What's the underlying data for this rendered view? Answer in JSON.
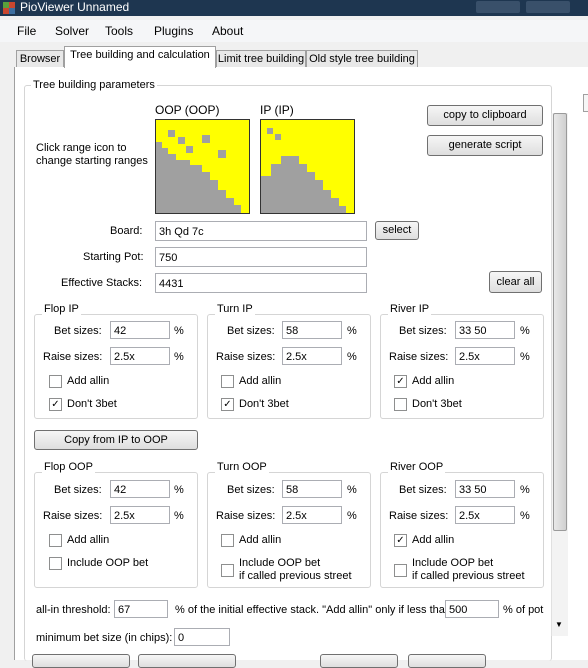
{
  "window": {
    "title": "PioViewer Unnamed"
  },
  "menu": [
    "File",
    "Solver",
    "Tools",
    "Plugins",
    "About"
  ],
  "tabs": [
    "Browser",
    "Tree building and calculation",
    "Limit tree building",
    "Old style tree building"
  ],
  "params": {
    "group_title": "Tree building parameters",
    "hint_line1": "Click range icon to",
    "hint_line2": "change starting ranges",
    "oop_label": "OOP (OOP)",
    "ip_label": "IP (IP)",
    "copy_button": "copy to clipboard",
    "script_button": "generate script",
    "board_label": "Board:",
    "board_value": "3h Qd 7c",
    "select_button": "select",
    "pot_label": "Starting Pot:",
    "pot_value": "750",
    "stacks_label": "Effective Stacks:",
    "stacks_value": "4431",
    "clear_button": "clear all"
  },
  "ranges": {
    "highlight_color": "#ffff00",
    "base_color": "#a0a0a0"
  },
  "ip_groups": [
    {
      "title": "Flop IP",
      "bet_label": "Bet sizes:",
      "bet": "42",
      "raise_label": "Raise sizes:",
      "raise": "2.5x",
      "pct": "%",
      "allin_label": "Add allin",
      "allin": "",
      "extra_label": "Don't 3bet",
      "extra": "✓"
    },
    {
      "title": "Turn IP",
      "bet_label": "Bet sizes:",
      "bet": "58",
      "raise_label": "Raise sizes:",
      "raise": "2.5x",
      "pct": "%",
      "allin_label": "Add allin",
      "allin": "",
      "extra_label": "Don't 3bet",
      "extra": "✓"
    },
    {
      "title": "River IP",
      "bet_label": "Bet sizes:",
      "bet": "33 50",
      "raise_label": "Raise sizes:",
      "raise": "2.5x",
      "pct": "%",
      "allin_label": "Add allin",
      "allin": "✓",
      "extra_label": "Don't 3bet",
      "extra": ""
    }
  ],
  "copy_ip_button": "Copy from IP to OOP",
  "oop_groups": [
    {
      "title": "Flop OOP",
      "bet_label": "Bet sizes:",
      "bet": "42",
      "raise_label": "Raise sizes:",
      "raise": "2.5x",
      "pct": "%",
      "allin_label": "Add allin",
      "allin": "",
      "extra_label": "Include OOP bet",
      "extra2": "",
      "extra": ""
    },
    {
      "title": "Turn OOP",
      "bet_label": "Bet sizes:",
      "bet": "58",
      "raise_label": "Raise sizes:",
      "raise": "2.5x",
      "pct": "%",
      "allin_label": "Add allin",
      "allin": "",
      "extra_label": "Include OOP bet",
      "extra2": "if called previous street",
      "extra": ""
    },
    {
      "title": "River OOP",
      "bet_label": "Bet sizes:",
      "bet": "33 50",
      "raise_label": "Raise sizes:",
      "raise": "2.5x",
      "pct": "%",
      "allin_label": "Add allin",
      "allin": "✓",
      "extra_label": "Include OOP bet",
      "extra2": "if called previous street",
      "extra": ""
    }
  ],
  "bottom": {
    "threshold_label": "all-in threshold:",
    "threshold_value": "67",
    "threshold_text": "% of the initial effective stack. \"Add allin\" only if less than",
    "limit_value": "500",
    "limit_suffix": "% of pot",
    "min_bet_label": "minimum bet size (in chips):",
    "min_bet_value": "0"
  }
}
